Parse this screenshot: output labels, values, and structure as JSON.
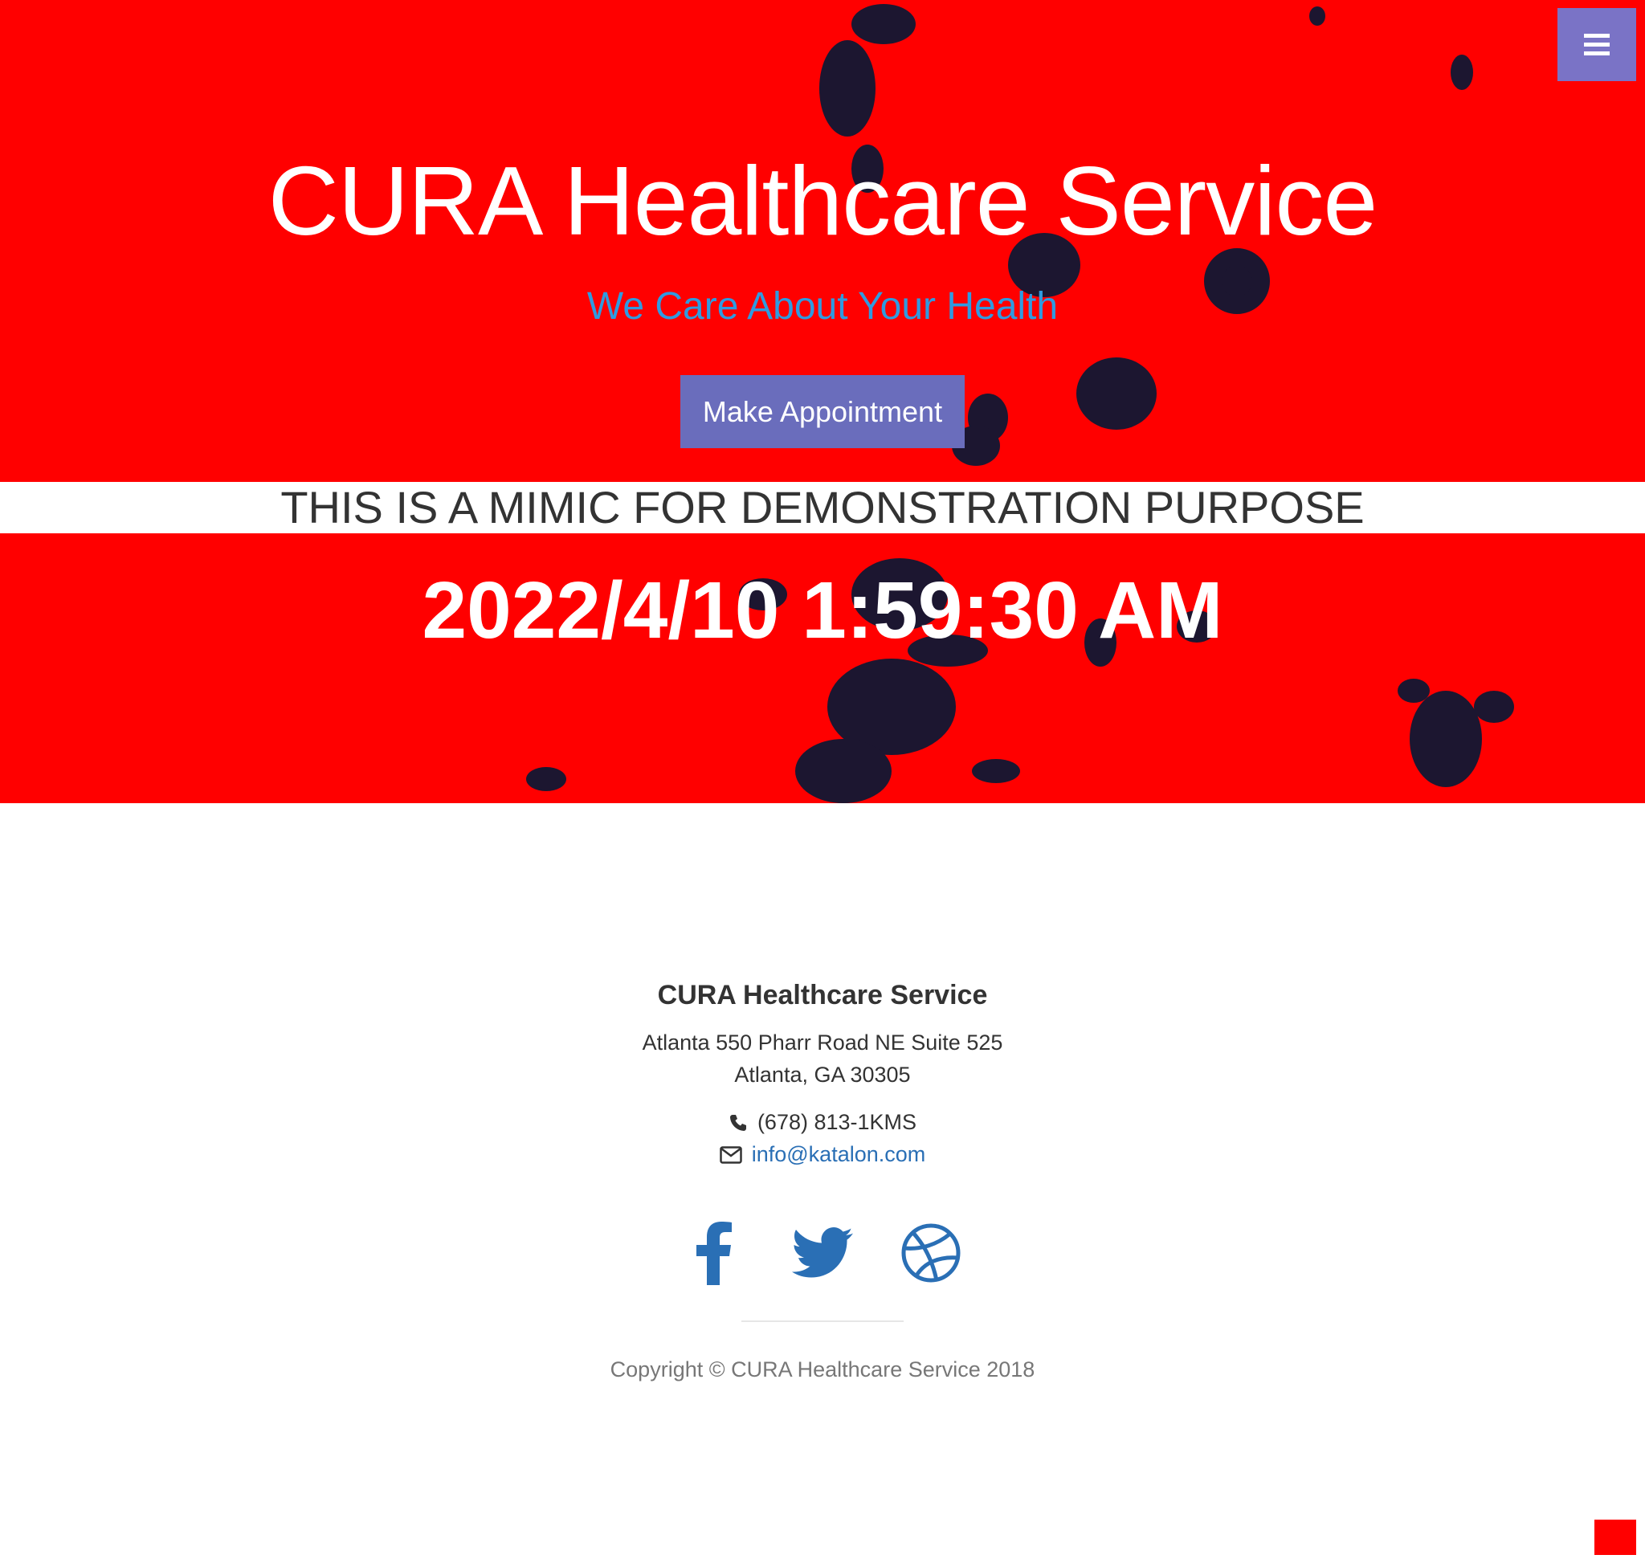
{
  "hero": {
    "title": "CURA Healthcare Service",
    "subtitle": "We Care About Your Health",
    "appointment_button": "Make Appointment",
    "background_color": "#ff0000"
  },
  "menu": {
    "toggle_icon": "hamburger-menu-icon",
    "color": "#7a73c6"
  },
  "banner": {
    "text": "THIS IS A MIMIC FOR DEMONSTRATION PURPOSE"
  },
  "counter": {
    "text": "2022/4/10 1:59:30 AM"
  },
  "footer": {
    "title": "CURA Healthcare Service",
    "address_line1": "Atlanta 550 Pharr Road NE Suite 525",
    "address_line2": "Atlanta, GA 30305",
    "phone": "(678) 813-1KMS",
    "email": "info@katalon.com",
    "social": [
      "facebook-icon",
      "twitter-icon",
      "dribbble-icon"
    ],
    "copyright": "Copyright © CURA Healthcare Service 2018",
    "link_color": "#2a6fb5"
  }
}
